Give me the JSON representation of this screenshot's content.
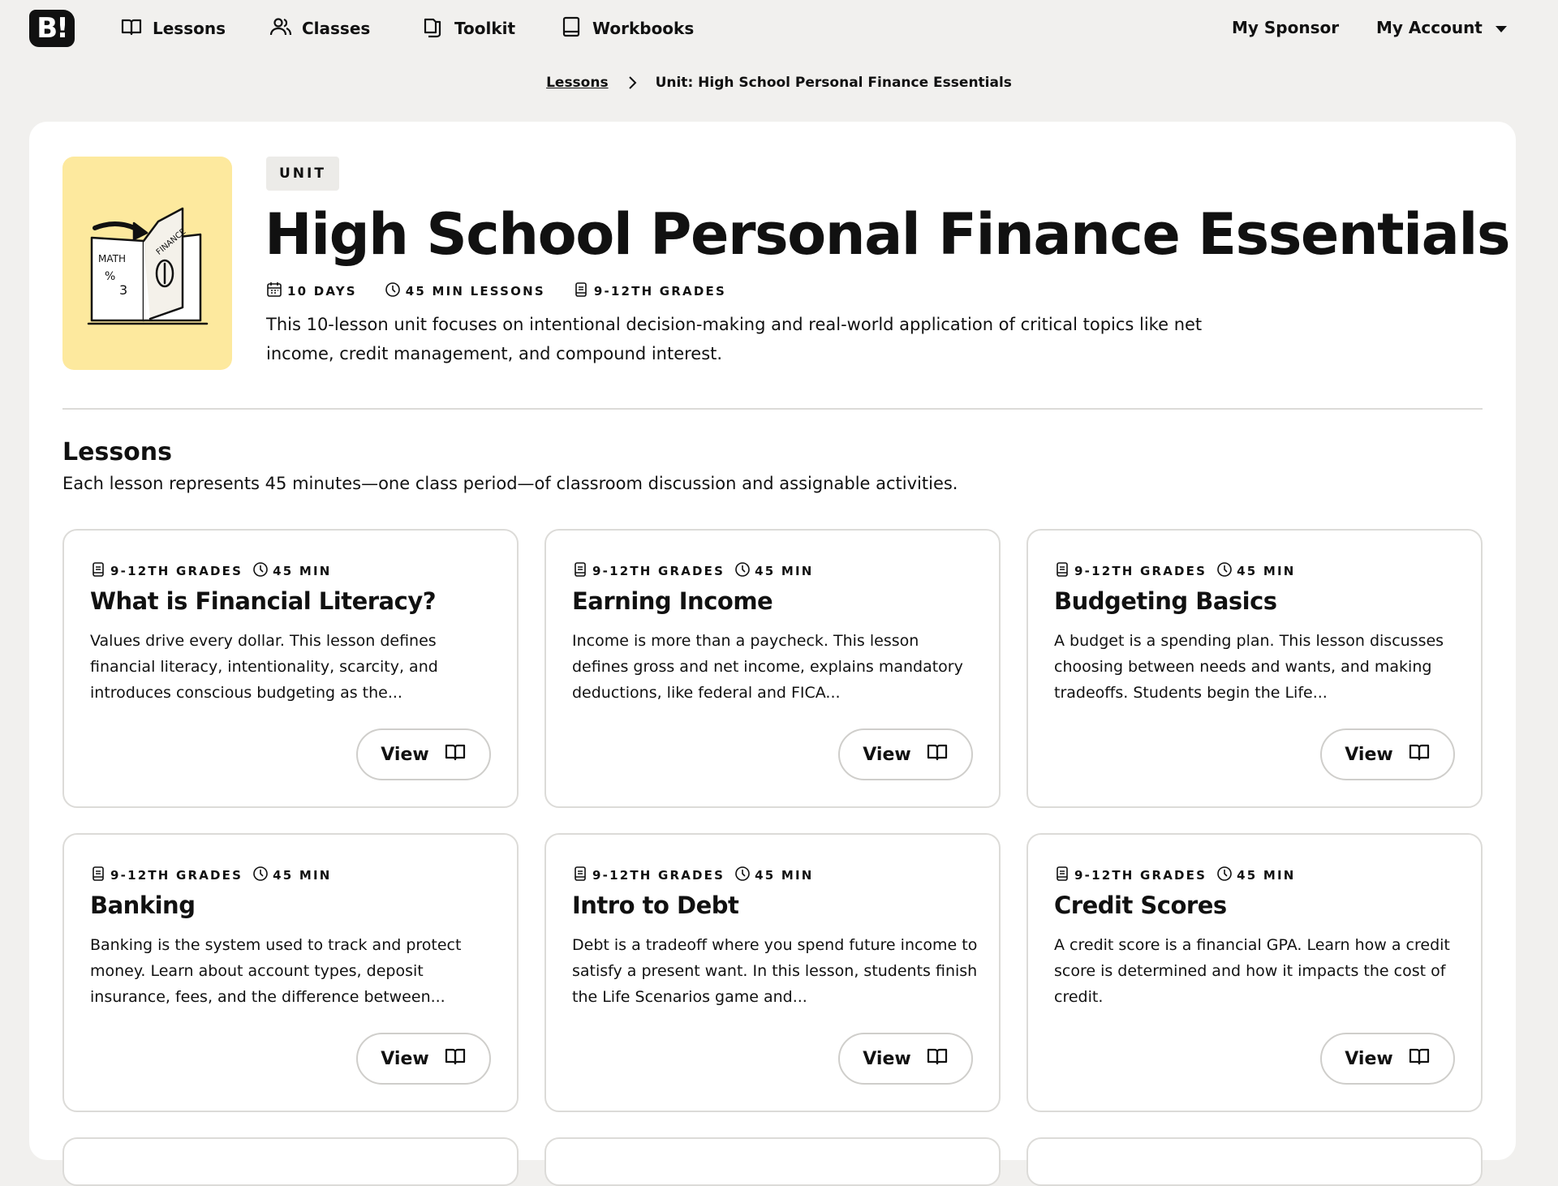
{
  "nav": {
    "logo": "B!",
    "items": [
      {
        "label": "Lessons",
        "icon": "open-book-icon"
      },
      {
        "label": "Classes",
        "icon": "users-icon"
      },
      {
        "label": "Toolkit",
        "icon": "folder-icon"
      },
      {
        "label": "Workbooks",
        "icon": "workbook-icon"
      }
    ],
    "sponsor": "My Sponsor",
    "account": "My Account"
  },
  "breadcrumb": {
    "parent": "Lessons",
    "current": "Unit: High School Personal Finance Essentials"
  },
  "unit": {
    "badge": "UNIT",
    "title": "High School Personal Finance Essentials",
    "days": "10 DAYS",
    "length": "45 MIN LESSONS",
    "grades": "9-12TH GRADES",
    "description": "This 10-lesson unit focuses on intentional decision-making and real-world application of critical topics like net income, credit management, and compound interest.",
    "image_labels": {
      "left": "MATH",
      "right": "FINANCE"
    }
  },
  "lessons_section": {
    "title": "Lessons",
    "subtitle": "Each lesson represents 45 minutes—one class period—of classroom discussion and assignable activities."
  },
  "lessons": [
    {
      "grades": "9-12TH GRADES",
      "time": "45 MIN",
      "title": "What is Financial Literacy?",
      "desc": "Values drive every dollar. This lesson defines financial literacy, intentionality, scarcity, and introduces conscious budgeting as the...",
      "button": "View"
    },
    {
      "grades": "9-12TH GRADES",
      "time": "45 MIN",
      "title": "Earning Income",
      "desc": "Income is more than a paycheck. This lesson defines gross and net income, explains mandatory deductions, like federal and FICA...",
      "button": "View"
    },
    {
      "grades": "9-12TH GRADES",
      "time": "45 MIN",
      "title": "Budgeting Basics",
      "desc": "A budget is a spending plan. This lesson discusses choosing between needs and wants, and making tradeoffs. Students begin the Life...",
      "button": "View"
    },
    {
      "grades": "9-12TH GRADES",
      "time": "45 MIN",
      "title": "Banking",
      "desc": "Banking is the system used to track and protect money. Learn about account types, deposit insurance, fees, and the difference between...",
      "button": "View"
    },
    {
      "grades": "9-12TH GRADES",
      "time": "45 MIN",
      "title": "Intro to Debt",
      "desc": "Debt is a tradeoff where you spend future income to satisfy a present want. In this lesson, students finish the Life Scenarios game and...",
      "button": "View"
    },
    {
      "grades": "9-12TH GRADES",
      "time": "45 MIN",
      "title": "Credit Scores",
      "desc": "A credit score is a financial GPA. Learn how a credit score is determined and how it impacts the cost of credit.",
      "button": "View"
    }
  ],
  "colors": {
    "page_bg": "#f1f0ee",
    "hero_bg": "#fde99e",
    "badge_bg": "#ecebe8",
    "border": "#dcdbd8"
  }
}
